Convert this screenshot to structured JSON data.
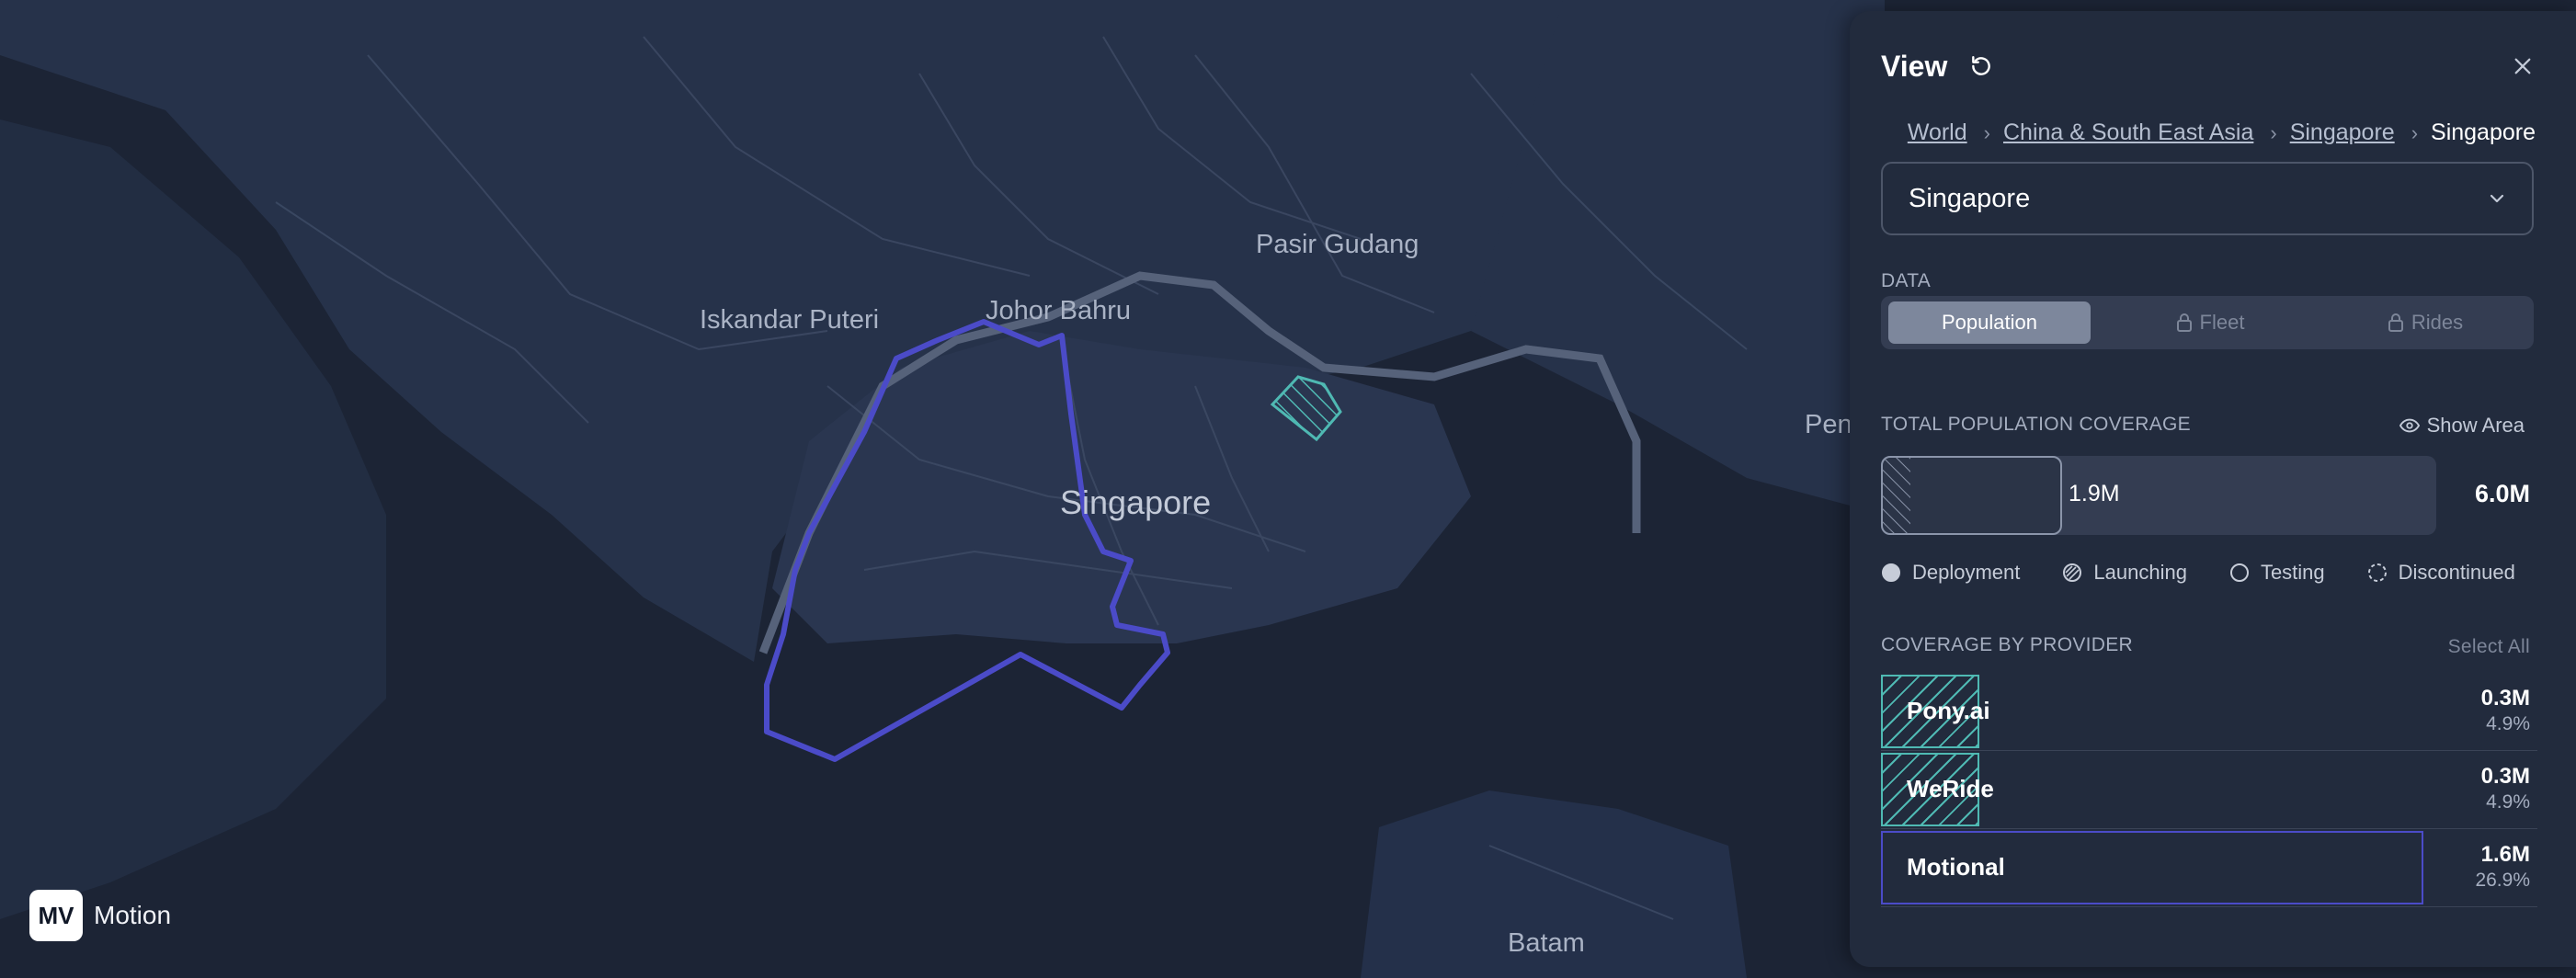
{
  "map": {
    "labels": {
      "iskandar": "Iskandar Puteri",
      "johor": "Johor Bahru",
      "pasir": "Pasir Gudang",
      "singapore": "Singapore",
      "peng": "Peng",
      "batam": "Batam"
    },
    "colors": {
      "water": "#1c2435",
      "land": "#26324a",
      "roads": "#4a5872",
      "boundary": "#4b4bc8",
      "coverage_teal": "#4fb9b3"
    }
  },
  "logo": {
    "mark": "MV",
    "name": "Motion"
  },
  "panel": {
    "title": "View",
    "breadcrumb": [
      "World",
      "China & South East Asia",
      "Singapore",
      "Singapore"
    ],
    "region_select": "Singapore",
    "data_label": "DATA",
    "data_tabs": [
      {
        "label": "Population",
        "active": true,
        "locked": false
      },
      {
        "label": "Fleet",
        "active": false,
        "locked": true
      },
      {
        "label": "Rides",
        "active": false,
        "locked": true
      }
    ],
    "coverage": {
      "label": "TOTAL POPULATION COVERAGE",
      "show_area": "Show Area",
      "covered": "1.9M",
      "total": "6.0M",
      "covered_fraction": 0.32,
      "launching_fraction": 0.05
    },
    "legend": [
      "Deployment",
      "Launching",
      "Testing",
      "Discontinued"
    ],
    "providers_label": "COVERAGE BY PROVIDER",
    "select_all": "Select All",
    "providers": [
      {
        "name": "Pony.ai",
        "value": "0.3M",
        "percent": "4.9%",
        "share": 0.049,
        "status": "launching",
        "color": "#4fb9b3"
      },
      {
        "name": "WeRide",
        "value": "0.3M",
        "percent": "4.9%",
        "share": 0.049,
        "status": "launching",
        "color": "#4fb9b3"
      },
      {
        "name": "Motional",
        "value": "1.6M",
        "percent": "26.9%",
        "share": 0.269,
        "status": "testing",
        "color": "#4b4bc8"
      }
    ]
  }
}
